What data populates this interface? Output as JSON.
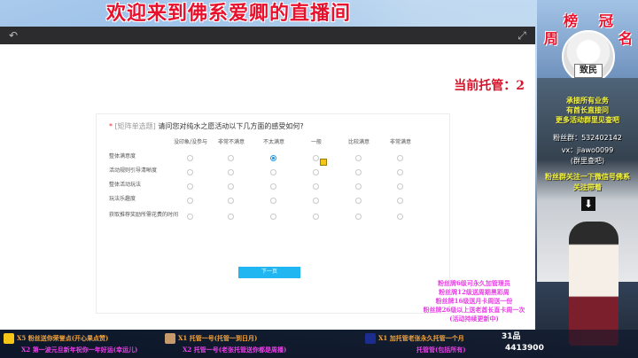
{
  "stream": {
    "title": "欢迎来到佛系爱卿的直播间",
    "trustee": "当前托管：2"
  },
  "survey": {
    "required_mark": "*",
    "tag": "[矩阵单选题]",
    "question": "请问您对纯水之愿活动以下几方面的感受如何?",
    "columns": [
      "没印象/没参与",
      "非常不满意",
      "不太满意",
      "一般",
      "比较满意",
      "非常满意"
    ],
    "rows": [
      {
        "label": "整体满意度",
        "selected": 2
      },
      {
        "label": "活动规则引导清晰度",
        "selected": -1
      },
      {
        "label": "整体活动玩法",
        "selected": -1
      },
      {
        "label": "玩法乐趣度",
        "selected": -1
      },
      {
        "label": "获取推荐奖励所需花费的时间",
        "selected": -1
      }
    ],
    "next_button": "下一页"
  },
  "sidebar": {
    "rank_label_a": "榜",
    "rank_label_b": "冠",
    "rank_label_c": "周",
    "rank_label_d": "名",
    "badge": "致民",
    "promo": [
      "承接所有业务",
      "有酋长直接问",
      "更多活动群里见查吧"
    ],
    "fan_group": "粉丝群：532402142",
    "vx": "vx：jiawo0099",
    "vx_note": "(群里查吧)",
    "subscribe": "粉丝群关注一下微信号佛系",
    "subscribe2": "关注带着"
  },
  "fan_messages": [
    "粉丝牌6级可永久加管理员",
    "粉丝牌12级送周期黑彩周",
    "粉丝牌16级送月卡周送一份",
    "粉丝牌26级以上送老酋长直卡周一次",
    "(活动持续更新中)"
  ],
  "gifts": [
    {
      "text": "X5 粉丝送你荣誉点(开心果点赞)",
      "color": "#f2a33a"
    },
    {
      "text": "X1 托管一号(托管一到日月)",
      "color": "#f2a33a"
    },
    {
      "text": "X1 加托管老张永久托管一个月",
      "color": "#f2a33a"
    },
    {
      "text": "X2 第一波元旦新年祝你一年好运(幸运儿)",
      "color": "#e93fe5"
    },
    {
      "text": "X2 托管一号(老张托管送你都是周播)",
      "color": "#e93fe5"
    },
    {
      "text": "托管管(包括所有)",
      "color": "#e93fe5"
    }
  ],
  "viewer_count": "4413900",
  "viewer_label": "31品"
}
